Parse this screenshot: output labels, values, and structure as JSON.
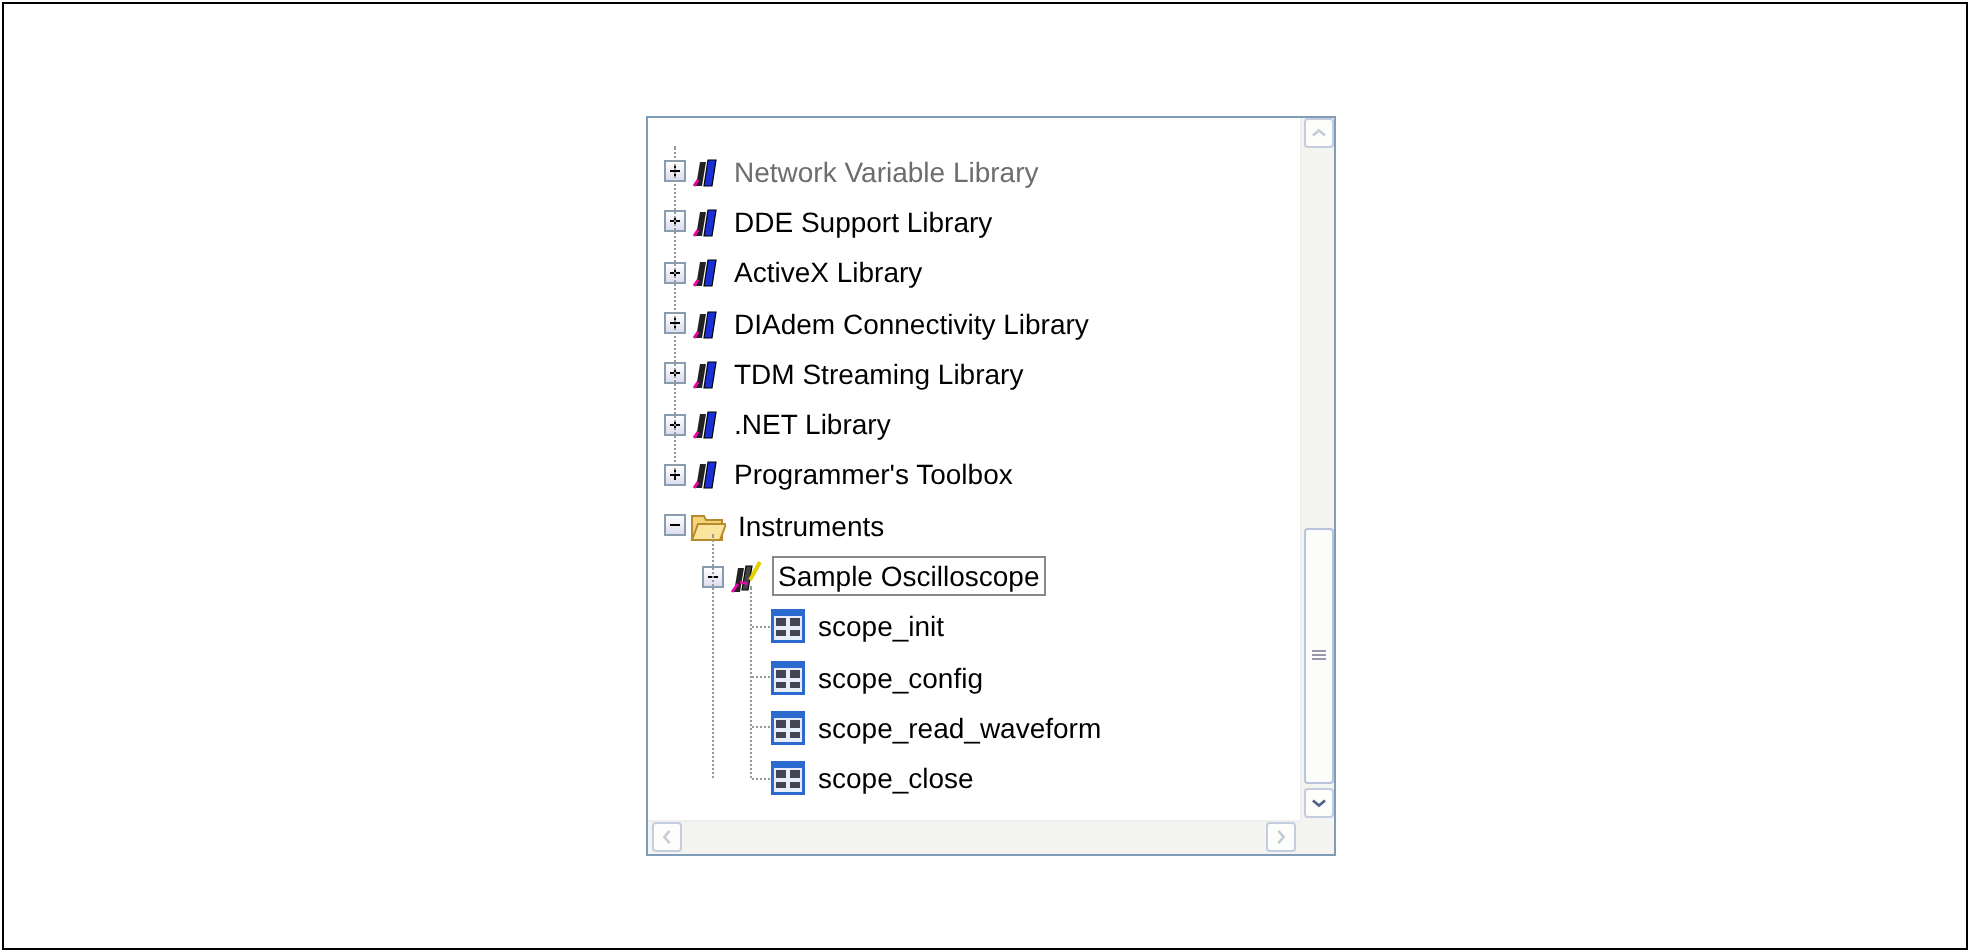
{
  "tree": {
    "nodes": [
      {
        "kind": "continued",
        "children": [
          {
            "label": "Network Variable Library",
            "kind": "library",
            "expanded": false,
            "disabled": true
          },
          {
            "label": "DDE Support Library",
            "kind": "library",
            "expanded": false,
            "disabled": false
          },
          {
            "label": "ActiveX Library",
            "kind": "library",
            "expanded": false,
            "disabled": false
          },
          {
            "label": "DIAdem Connectivity Library",
            "kind": "library",
            "expanded": false,
            "disabled": false
          },
          {
            "label": "TDM Streaming Library",
            "kind": "library",
            "expanded": false,
            "disabled": false
          },
          {
            "label": ".NET Library",
            "kind": "library",
            "expanded": false,
            "disabled": false
          },
          {
            "label": "Programmer's Toolbox",
            "kind": "library",
            "expanded": false,
            "disabled": false
          }
        ]
      },
      {
        "kind": "folder",
        "label": "Instruments",
        "expanded": true,
        "disabled": false,
        "children": [
          {
            "label": "Sample Oscilloscope",
            "kind": "instrument",
            "expanded": true,
            "selected": true,
            "disabled": false,
            "children": [
              {
                "label": "scope_init",
                "kind": "function",
                "disabled": false
              },
              {
                "label": "scope_config",
                "kind": "function",
                "disabled": false
              },
              {
                "label": "scope_read_waveform",
                "kind": "function",
                "disabled": false
              },
              {
                "label": "scope_close",
                "kind": "function",
                "disabled": false
              }
            ]
          }
        ]
      }
    ]
  }
}
